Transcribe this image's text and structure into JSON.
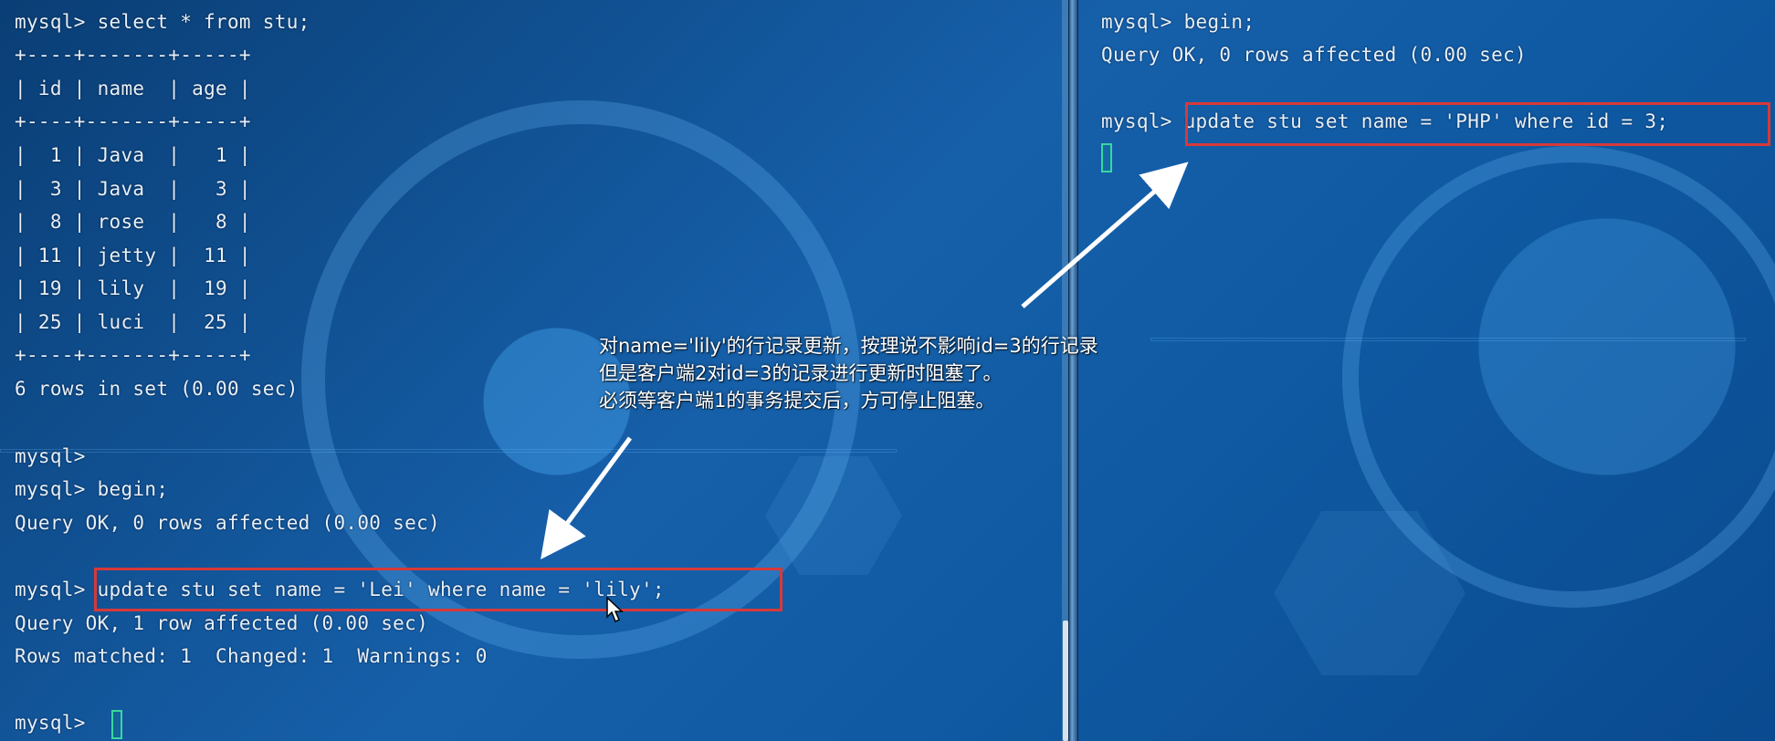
{
  "left_terminal": {
    "lines": [
      "mysql> select * from stu;",
      "+----+-------+-----+",
      "| id | name  | age |",
      "+----+-------+-----+",
      "|  1 | Java  |   1 |",
      "|  3 | Java  |   3 |",
      "|  8 | rose  |   8 |",
      "| 11 | jetty |  11 |",
      "| 19 | lily  |  19 |",
      "| 25 | luci  |  25 |",
      "+----+-------+-----+",
      "6 rows in set (0.00 sec)",
      "",
      "mysql>",
      "mysql> begin;",
      "Query OK, 0 rows affected (0.00 sec)",
      "",
      "mysql> update stu set name = 'Lei' where name = 'lily';",
      "Query OK, 1 row affected (0.00 sec)",
      "Rows matched: 1  Changed: 1  Warnings: 0",
      "",
      "mysql>"
    ]
  },
  "right_terminal": {
    "lines": [
      "mysql> begin;",
      "Query OK, 0 rows affected (0.00 sec)",
      "",
      "mysql> update stu set name = 'PHP' where id = 3;"
    ]
  },
  "annotation": {
    "line1": "对name='lily'的行记录更新，按理说不影响id=3的行记录",
    "line2": "但是客户端2对id=3的记录进行更新时阻塞了。",
    "line3": "必须等客户端1的事务提交后，方可停止阻塞。"
  },
  "colors": {
    "background": "#1660aa",
    "text": "#e7f0f8",
    "highlight_box": "#d73939",
    "cursor": "#39d7a0",
    "arrow": "#ffffff"
  }
}
